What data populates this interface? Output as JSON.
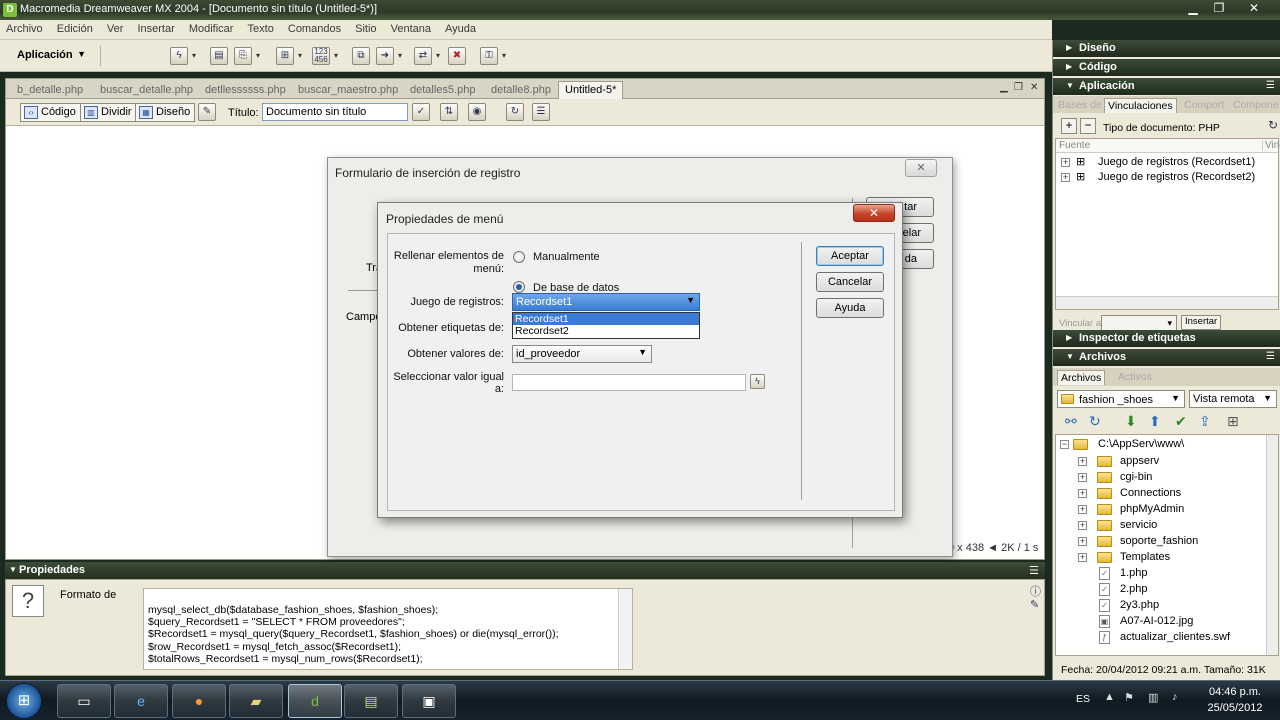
{
  "window": {
    "title": "Macromedia Dreamweaver MX 2004 - [Documento sin título (Untitled-5*)]",
    "min": "▁",
    "restore": "❐",
    "close": "✕"
  },
  "menu": [
    "Archivo",
    "Edición",
    "Ver",
    "Insertar",
    "Modificar",
    "Texto",
    "Comandos",
    "Sitio",
    "Ventana",
    "Ayuda"
  ],
  "insertbar": {
    "category": "Aplicación"
  },
  "doc": {
    "tabs": [
      "b_detalle.php",
      "buscar_detalle.php",
      "detllessssss.php",
      "buscar_maestro.php",
      "detalles5.php",
      "detalle8.php",
      "Untitled-5*"
    ],
    "views": {
      "code": "Código",
      "split": "Dividir",
      "design": "Diseño"
    },
    "title_label": "Título:",
    "title_value": "Documento sin título",
    "status_size": "9 x 438 ◄ 2K / 1 s"
  },
  "dialog_insert": {
    "title": "Formulario de inserción de registro",
    "bg_btn1": "tar",
    "bg_btn2": "elar",
    "bg_btn3": "da",
    "bg_label1": "Tra",
    "bg_label2": "Campo"
  },
  "dialog_menu": {
    "title": "Propiedades de menú",
    "fill_label": "Rellenar elementos de menú:",
    "radio_manual": "Manualmente",
    "radio_db": "De base de datos",
    "recordset_label": "Juego de registros:",
    "recordset_value": "Recordset1",
    "recordset_options": [
      "Recordset1",
      "Recordset2"
    ],
    "labels_label": "Obtener etiquetas de:",
    "values_label": "Obtener valores de:",
    "values_value": "id_proveedor",
    "select_equal_label": "Seleccionar valor igual a:",
    "btn_ok": "Aceptar",
    "btn_cancel": "Cancelar",
    "btn_help": "Ayuda"
  },
  "properties": {
    "header": "Propiedades",
    "format_label": "Formato de",
    "code_lines": [
      "mysql_select_db($database_fashion_shoes, $fashion_shoes);",
      "$query_Recordset1 = \"SELECT * FROM proveedores\";",
      "$Recordset1 = mysql_query($query_Recordset1, $fashion_shoes) or die(mysql_error());",
      "$row_Recordset1 = mysql_fetch_assoc($Recordset1);",
      "$totalRows_Recordset1 = mysql_num_rows($Recordset1);"
    ]
  },
  "panels": {
    "design": "Diseño",
    "code": "Código",
    "application": "Aplicación",
    "app_tabs": [
      "Bases de",
      "Vinculaciones",
      "Comport",
      "Compone"
    ],
    "doc_type": "Tipo de documento: PHP",
    "col_source": "Fuente",
    "col_bind": "Vinc",
    "bindings": [
      "Juego de registros (Recordset1)",
      "Juego de registros (Recordset2)"
    ],
    "bind_to": "Vincular a:",
    "insert_btn": "Insertar",
    "tag_inspector": "Inspector de etiquetas",
    "files": "Archivos",
    "files_tabs": [
      "Archivos",
      "Activos"
    ],
    "site": "fashion _shoes",
    "view": "Vista remota",
    "root": "C:\\AppServ\\www\\",
    "folders": [
      "appserv",
      "cgi-bin",
      "Connections",
      "phpMyAdmin",
      "servicio",
      "soporte_fashion",
      "Templates"
    ],
    "files_list": [
      "1.php",
      "2.php",
      "2y3.php",
      "A07-AI-012.jpg",
      "actualizar_clientes.swf"
    ],
    "status": "Fecha: 20/04/2012 09:21 a.m. Tamaño: 31K"
  },
  "taskbar": {
    "lang": "ES",
    "time": "04:46 p.m.",
    "date": "25/05/2012"
  }
}
